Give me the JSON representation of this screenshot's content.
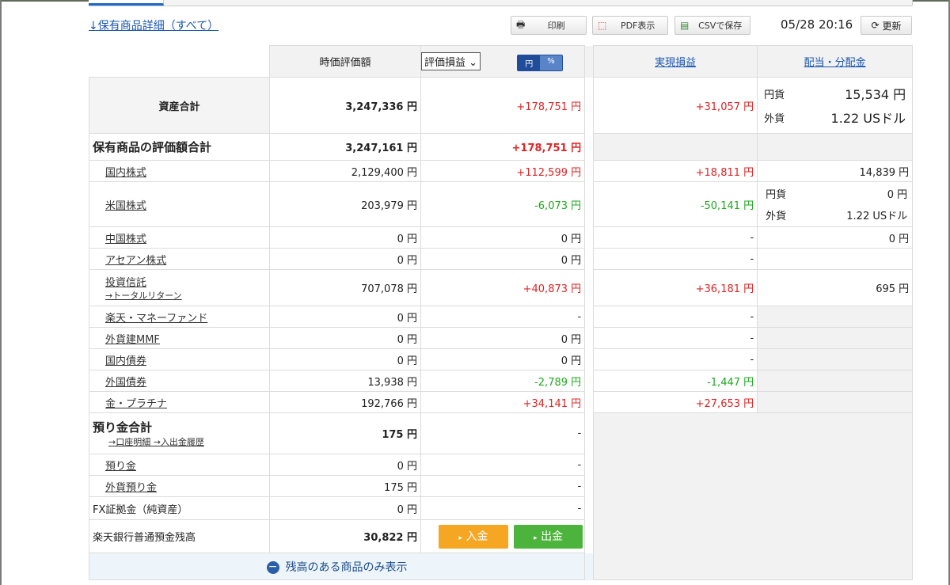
{
  "toolbar": {
    "detail_link": "↓保有商品詳細（すべて）",
    "print_label": "印刷",
    "pdf_label": "PDF表示",
    "csv_label": "CSVで保存",
    "timestamp": "05/28 20:16",
    "refresh_label": "更新"
  },
  "header": {
    "market_value": "時価評価額",
    "pl_select": "評価損益",
    "toggle_yen": "円",
    "toggle_pct": "%",
    "realized": "実現損益",
    "dividend": "配当・分配金"
  },
  "asset_total": {
    "label": "資産合計",
    "value": "3,247,336 円",
    "pl": "+178,751 円",
    "realized": "+31,057 円",
    "div_yen_label": "円貨",
    "div_yen": "15,534 円",
    "div_fx_label": "外貨",
    "div_fx": "1.22 USドル"
  },
  "holdings_total": {
    "label": "保有商品の評価額合計",
    "value": "3,247,161 円",
    "pl": "+178,751 円"
  },
  "rows": [
    {
      "name": "国内株式",
      "value": "2,129,400 円",
      "pl": "+112,599 円",
      "realized": "+18,811 円",
      "dividend": "14,839 円"
    },
    {
      "name": "米国株式",
      "value": "203,979 円",
      "pl": "-6,073 円",
      "realized": "-50,141 円",
      "div_yen_label": "円貨",
      "div_yen": "0 円",
      "div_fx_label": "外貨",
      "div_fx": "1.22 USドル"
    },
    {
      "name": "中国株式",
      "value": "0 円",
      "pl": "0 円",
      "realized": "-",
      "dividend": "0 円"
    },
    {
      "name": "アセアン株式",
      "value": "0 円",
      "pl": "0 円",
      "realized": "-"
    },
    {
      "name": "投資信託",
      "sub": "→トータルリターン",
      "value": "707,078 円",
      "pl": "+40,873 円",
      "realized": "+36,181 円",
      "dividend": "695 円"
    },
    {
      "name": "楽天・マネーファンド",
      "value": "0 円",
      "pl": "-",
      "realized": "-"
    },
    {
      "name": "外貨建MMF",
      "value": "0 円",
      "pl": "0 円",
      "realized": "-"
    },
    {
      "name": "国内債券",
      "value": "0 円",
      "pl": "0 円",
      "realized": "-"
    },
    {
      "name": "外国債券",
      "value": "13,938 円",
      "pl": "-2,789 円",
      "realized": "-1,447 円"
    },
    {
      "name": "金・プラチナ",
      "value": "192,766 円",
      "pl": "+34,141 円",
      "realized": "+27,653 円"
    }
  ],
  "deposit": {
    "label": "預り金合計",
    "links": "→口座明細 →入出金履歴",
    "value": "175 円",
    "pl": "-",
    "yen_label": "預り金",
    "yen_value": "0 円",
    "yen_pl": "-",
    "fx_label": "外貨預り金",
    "fx_value": "175 円",
    "fx_pl": "-"
  },
  "fx": {
    "label": "FX証拠金（純資産）",
    "value": "0 円",
    "pl": "-"
  },
  "bank": {
    "label": "楽天銀行普通預金残高",
    "value": "30,822 円",
    "deposit_btn": "入金",
    "withdraw_btn": "出金"
  },
  "footer": {
    "toggle_label": "残高のある商品のみ表示"
  }
}
